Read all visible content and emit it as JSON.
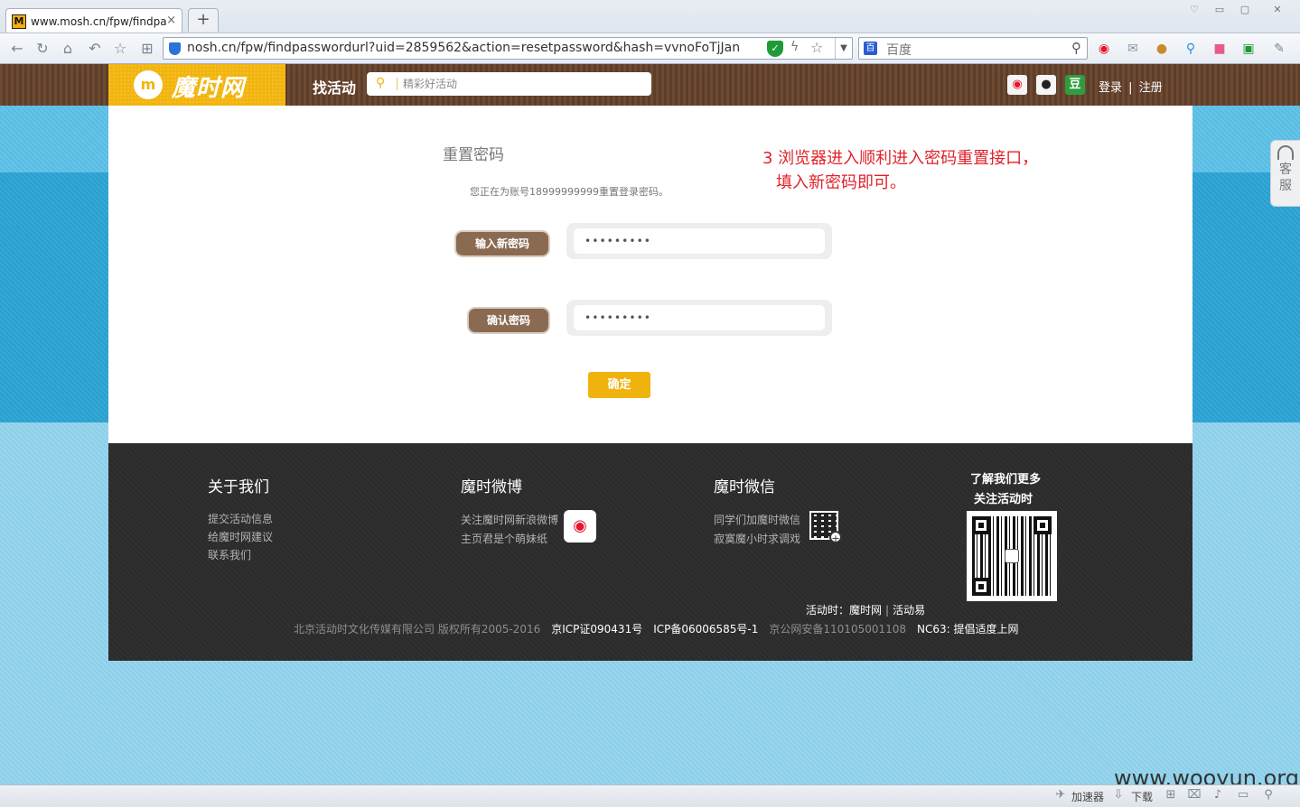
{
  "browser": {
    "tab": {
      "favicon_letter": "M",
      "title": "www.mosh.cn/fpw/findpa",
      "close": "×"
    },
    "new_tab": "+",
    "url": "nosh.cn/fpw/findpasswordurl?uid=2859562&action=resetpassword&hash=vvnoFoTjJan",
    "search_engine": "百度",
    "search_engine_logo": "百"
  },
  "site": {
    "logo_mark": "m",
    "logo_text": "魔时网",
    "find_label": "找活动",
    "search_placeholder": "精彩好活动",
    "social": {
      "douban": "豆"
    },
    "login": "登录",
    "divider": "|",
    "register": "注册"
  },
  "reset": {
    "title": "重置密码",
    "description": "您正在为账号18999999999重置登录密码。",
    "new_password_label": "输入新密码",
    "new_password_value": "•••••••••",
    "confirm_label": "确认密码",
    "confirm_value": "•••••••••",
    "submit_label": "确定"
  },
  "annotation": {
    "line1": "3 浏览器进入顺利进入密码重置接口，",
    "line2": "填入新密码即可。"
  },
  "service": {
    "label": "客服"
  },
  "footer": {
    "about": {
      "title": "关于我们",
      "links": [
        "提交活动信息",
        "给魔时网建议",
        "联系我们"
      ]
    },
    "weibo": {
      "title": "魔时微博",
      "lines": [
        "关注魔时网新浪微博",
        "主页君是个萌妹纸"
      ]
    },
    "wechat": {
      "title": "魔时微信",
      "lines": [
        "同学们加魔时微信",
        "寂寞魔小时求调戏"
      ]
    },
    "learn_more": [
      "了解我们更多",
      "关注活动时"
    ],
    "row1": {
      "prefix": "活动时：",
      "site1": "魔时网",
      "sep": "|",
      "site2": "活动易"
    },
    "row2": {
      "copyright": "北京活动时文化传媒有限公司 版权所有2005-2016",
      "icp1": "京ICP证090431号",
      "icp2": "ICP备06006585号-1",
      "police": "京公网安备110105001108",
      "nc": "NC63: 提倡适度上网"
    }
  },
  "statusbar": {
    "accelerator": "加速器",
    "download": "下载"
  },
  "watermark": "www.wooyun.org",
  "colors": {
    "brand_yellow": "#f2b40d",
    "header_brown": "#6d4a33",
    "label_brown": "#8b6a52",
    "annotation_red": "#e0222a"
  }
}
